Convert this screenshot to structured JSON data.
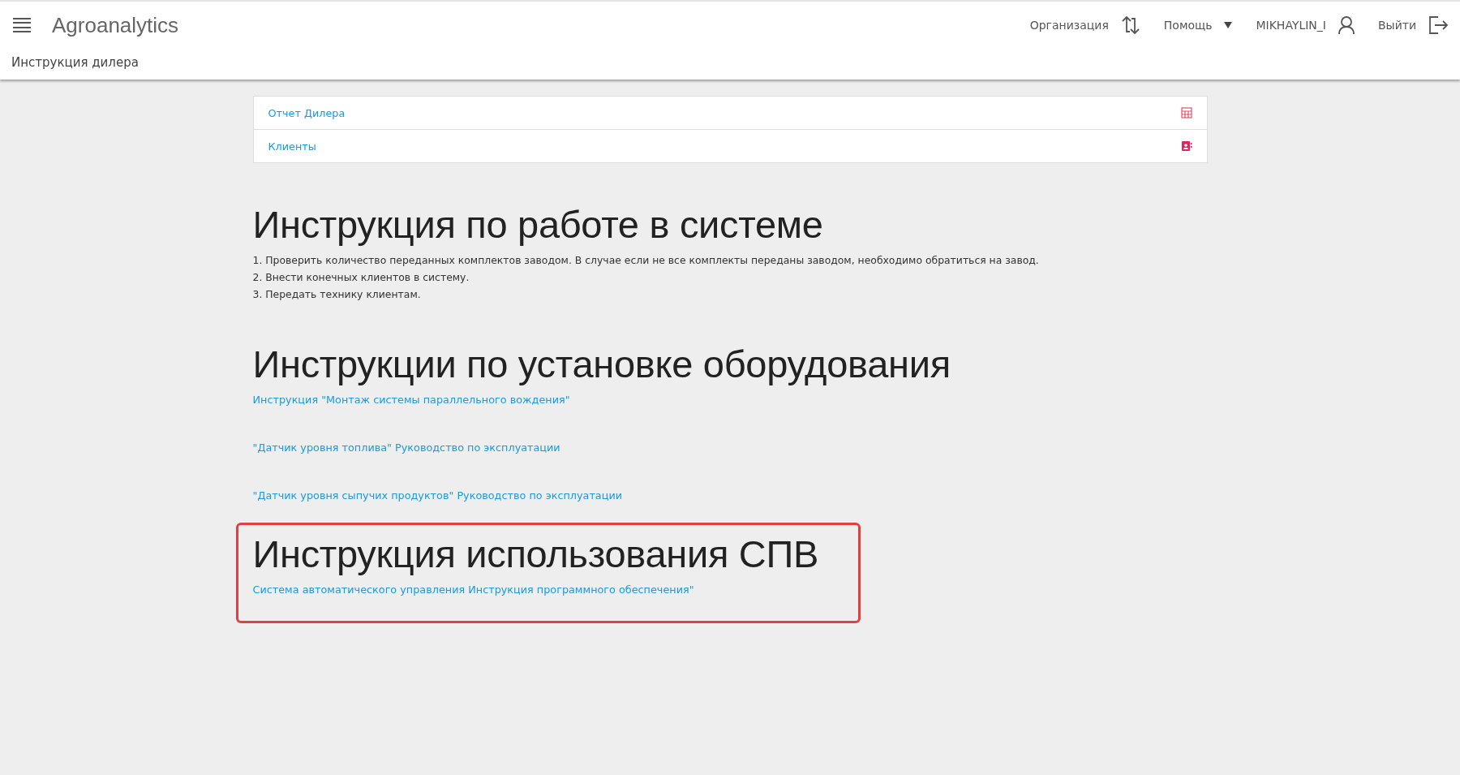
{
  "header": {
    "app_title": "Agroanalytics",
    "page_title": "Инструкция дилера",
    "nav": [
      {
        "kind": "org",
        "label": "Организация"
      },
      {
        "kind": "help",
        "label": "Помощь"
      },
      {
        "kind": "user",
        "label": "MIKHAYLIN_I"
      },
      {
        "kind": "logout",
        "label": "Выйти"
      }
    ]
  },
  "menu_list": [
    {
      "label": "Отчет Дилера",
      "kind": "table"
    },
    {
      "label": "Клиенты",
      "kind": "contacts"
    }
  ],
  "sections": [
    {
      "title": "Инструкция по работе в системе",
      "highlighted": false,
      "steps": [
        "1. Проверить количество переданных комплектов заводом. В случае если не все комплекты переданы заводом, необходимо обратиться на завод.",
        "2. Внести конечных клиентов в систему.",
        "3. Передать технику клиентам."
      ]
    },
    {
      "title": "Инструкции по установке оборудования",
      "highlighted": false,
      "links": [
        "Инструкция \"Монтаж системы параллельного вождения\"",
        "\"Датчик уровня топлива\" Руководство по эксплуатации",
        "\"Датчик уровня сыпучих продуктов\" Руководство по эксплуатации"
      ]
    },
    {
      "title": "Инструкция использования СПВ",
      "highlighted": true,
      "links": [
        "Система автоматического управления Инструкция программного обеспечения\""
      ]
    }
  ]
}
